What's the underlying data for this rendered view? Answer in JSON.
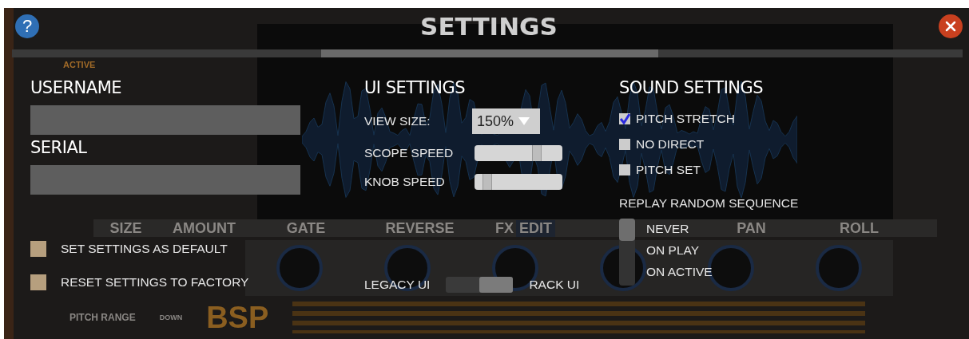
{
  "background_panel": {
    "labels": [
      {
        "kind": "power",
        "text": "ACTIVE"
      },
      {
        "kind": "strip",
        "text": "SIZE"
      },
      {
        "kind": "strip",
        "text": "AMOUNT"
      },
      {
        "kind": "strip",
        "text": "GATE"
      },
      {
        "kind": "strip",
        "text": "REVERSE"
      },
      {
        "kind": "strip",
        "text": "FX"
      },
      {
        "kind": "edit",
        "text": "EDIT"
      },
      {
        "kind": "strip",
        "text": "PAN"
      },
      {
        "kind": "strip",
        "text": "ROLL"
      },
      {
        "kind": "footer",
        "text": "PITCH RANGE"
      },
      {
        "kind": "small",
        "text": "DOWN"
      },
      {
        "kind": "logo",
        "text": "BSP"
      }
    ]
  },
  "header": {
    "help": "?",
    "title": "SETTINGS"
  },
  "account": {
    "fields": [
      {
        "label": "USERNAME"
      },
      {
        "label": "SERIAL"
      }
    ],
    "actions": [
      "SET SETTINGS AS DEFAULT",
      "RESET SETTINGS TO FACTORY"
    ]
  },
  "ui_settings": {
    "heading": "UI SETTINGS",
    "view_size": {
      "label": "VIEW SIZE:",
      "value": "150%"
    },
    "sliders": [
      {
        "label": "SCOPE SPEED",
        "level": 0.72
      },
      {
        "label": "KNOB SPEED",
        "level": 0.1
      }
    ],
    "ui_mode": [
      {
        "label": "LEGACY UI",
        "selected": false
      },
      {
        "label": "RACK UI",
        "selected": true
      }
    ]
  },
  "sound_settings": {
    "heading": "SOUND SETTINGS",
    "options": [
      {
        "label": "PITCH STRETCH",
        "checked": true
      },
      {
        "label": "NO DIRECT",
        "checked": false
      },
      {
        "label": "PITCH SET",
        "checked": false
      }
    ],
    "replay": {
      "heading": "REPLAY RANDOM SEQUENCE",
      "options": [
        {
          "label": "NEVER",
          "selected": true
        },
        {
          "label": "ON PLAY",
          "selected": false
        },
        {
          "label": "ON ACTIVE",
          "selected": false
        }
      ]
    }
  }
}
